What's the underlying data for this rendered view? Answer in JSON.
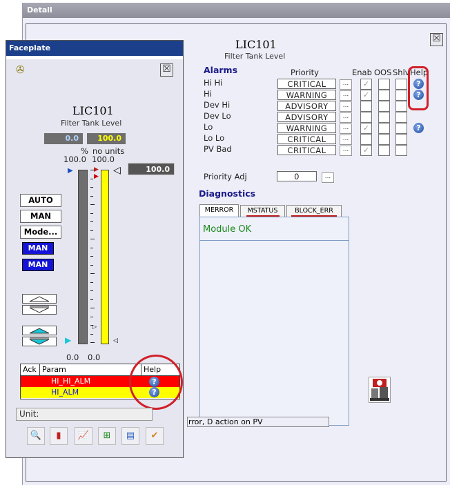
{
  "detail": {
    "title": "Detail",
    "close_glyph": "☒",
    "tag": "LIC101",
    "description": "Filter Tank Level",
    "alarms_header": "Alarms",
    "col_priority": "Priority",
    "col_enab": "Enab",
    "col_oos": "OOS",
    "col_shlv": "Shlv",
    "col_help": "Help",
    "alarm_rows": [
      {
        "name": "Hi Hi",
        "priority": "CRITICAL",
        "enabled": true,
        "help": true
      },
      {
        "name": "Hi",
        "priority": "WARNING",
        "enabled": true,
        "help": true
      },
      {
        "name": "Dev Hi",
        "priority": "ADVISORY",
        "enabled": false,
        "help": false
      },
      {
        "name": "Dev Lo",
        "priority": "ADVISORY",
        "enabled": false,
        "help": false
      },
      {
        "name": "Lo",
        "priority": "WARNING",
        "enabled": true,
        "help": true
      },
      {
        "name": "Lo Lo",
        "priority": "CRITICAL",
        "enabled": false,
        "help": false
      },
      {
        "name": "PV Bad",
        "priority": "CRITICAL",
        "enabled": true,
        "help": false
      }
    ],
    "priority_adj_label": "Priority Adj",
    "priority_adj_value": "0",
    "ellipsis": "...",
    "diagnostics_header": "Diagnostics",
    "tabs": [
      "MERROR",
      "MSTATUS",
      "BLOCK_ERR"
    ],
    "module_status": "Module OK",
    "status_text": "rror, D action on PV"
  },
  "faceplate": {
    "title": "Faceplate",
    "tag": "LIC101",
    "description": "Filter Tank Level",
    "pv_value": "0.0",
    "sp_value": "100.0",
    "pv_units": "%",
    "sp_units": "no units",
    "pv_range_hi": "100.0",
    "sp_range_hi": "100.0",
    "pv_range_lo": "0.0",
    "sp_range_lo": "0.0",
    "output_value": "100.0",
    "buttons": [
      "AUTO",
      "MAN",
      "Mode..."
    ],
    "mode_actual": "MAN",
    "mode_target": "MAN",
    "alarm_table": {
      "col_ack": "Ack",
      "col_param": "Param",
      "col_help": "Help",
      "rows": [
        {
          "param": "HI_HI_ALM",
          "color": "#ff0000"
        },
        {
          "param": "HI_ALM",
          "color": "#ffff00"
        }
      ]
    },
    "unit_label": "Unit:",
    "tool_icons": [
      "search-icon",
      "tank-icon",
      "trend-icon",
      "network-icon",
      "chart-icon",
      "check-icon"
    ]
  },
  "colors": {
    "critical": "#ff0000",
    "warning": "#ffff00",
    "highlight": "#d0202a",
    "mode_blue": "#1414d8",
    "title_blue": "#1c3f8c",
    "sp_yellow": "#ffff00"
  },
  "bars": {
    "pv_level": 0.0,
    "sp_level": 1.0
  }
}
